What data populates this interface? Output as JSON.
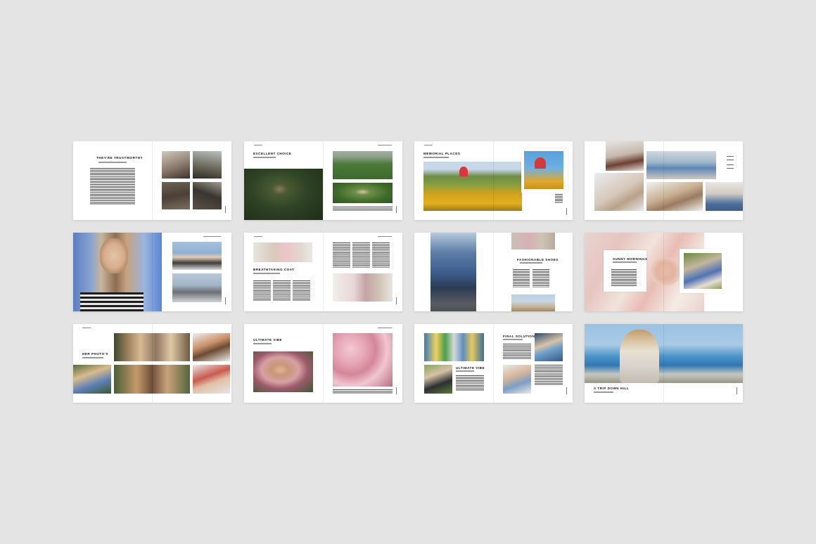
{
  "spreads": [
    {
      "heading": "THEY'RE TRUSTWORTHY"
    },
    {
      "heading": "EXCELLENT CHOICE"
    },
    {
      "heading": "MEMORIAL PLACES"
    },
    {
      "heading": ""
    },
    {
      "heading": ""
    },
    {
      "heading": "BREATHTAKING COAT"
    },
    {
      "heading": "FASHIONABLE SHOES"
    },
    {
      "heading": "SUNNY MORNINGS"
    },
    {
      "heading": "HER PHOTO'S"
    },
    {
      "heading": "ULTIMATE VIBE"
    },
    {
      "heading": "FINAL SOLUTION",
      "heading2": "ULTIMATE VIBE"
    },
    {
      "heading": "A TRIP DOWN HILL"
    }
  ]
}
